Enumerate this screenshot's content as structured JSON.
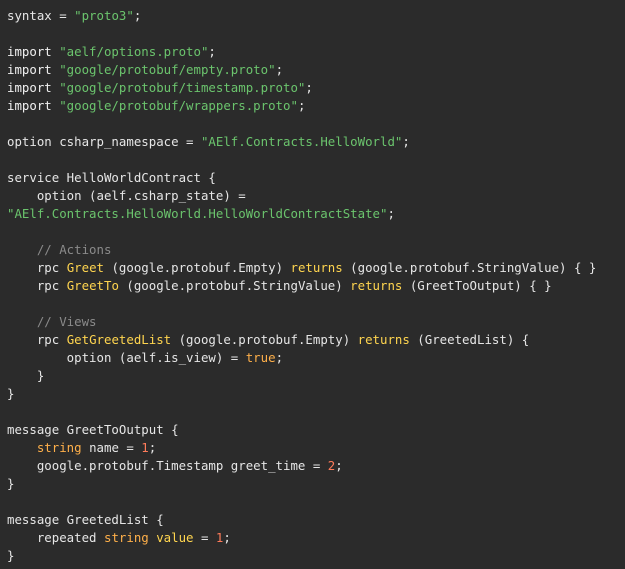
{
  "code": {
    "lines": [
      [
        {
          "t": "syntax = ",
          "c": "plain"
        },
        {
          "t": "\"proto3\"",
          "c": "string"
        },
        {
          "t": ";",
          "c": "punct"
        }
      ],
      [],
      [
        {
          "t": "import ",
          "c": "keyword"
        },
        {
          "t": "\"aelf/options.proto\"",
          "c": "string"
        },
        {
          "t": ";",
          "c": "punct"
        }
      ],
      [
        {
          "t": "import ",
          "c": "keyword"
        },
        {
          "t": "\"google/protobuf/empty.proto\"",
          "c": "string"
        },
        {
          "t": ";",
          "c": "punct"
        }
      ],
      [
        {
          "t": "import ",
          "c": "keyword"
        },
        {
          "t": "\"google/protobuf/timestamp.proto\"",
          "c": "string"
        },
        {
          "t": ";",
          "c": "punct"
        }
      ],
      [
        {
          "t": "import ",
          "c": "keyword"
        },
        {
          "t": "\"google/protobuf/wrappers.proto\"",
          "c": "string"
        },
        {
          "t": ";",
          "c": "punct"
        }
      ],
      [],
      [
        {
          "t": "option csharp_namespace = ",
          "c": "plain"
        },
        {
          "t": "\"AElf.Contracts.HelloWorld\"",
          "c": "string"
        },
        {
          "t": ";",
          "c": "punct"
        }
      ],
      [],
      [
        {
          "t": "service HelloWorldContract {",
          "c": "plain"
        }
      ],
      [
        {
          "t": "    option (aelf.csharp_state) =",
          "c": "plain"
        }
      ],
      [
        {
          "t": "\"AElf.Contracts.HelloWorld.HelloWorldContractState\"",
          "c": "string"
        },
        {
          "t": ";",
          "c": "punct"
        }
      ],
      [],
      [
        {
          "t": "    ",
          "c": "plain"
        },
        {
          "t": "// Actions",
          "c": "comment"
        }
      ],
      [
        {
          "t": "    rpc ",
          "c": "plain"
        },
        {
          "t": "Greet",
          "c": "func"
        },
        {
          "t": " (google.protobuf.Empty) ",
          "c": "plain"
        },
        {
          "t": "returns",
          "c": "func"
        },
        {
          "t": " (google.protobuf.StringValue) { }",
          "c": "plain"
        }
      ],
      [
        {
          "t": "    rpc ",
          "c": "plain"
        },
        {
          "t": "GreetTo",
          "c": "func"
        },
        {
          "t": " (google.protobuf.StringValue) ",
          "c": "plain"
        },
        {
          "t": "returns",
          "c": "func"
        },
        {
          "t": " (GreetToOutput) { }",
          "c": "plain"
        }
      ],
      [],
      [
        {
          "t": "    ",
          "c": "plain"
        },
        {
          "t": "// Views",
          "c": "comment"
        }
      ],
      [
        {
          "t": "    rpc ",
          "c": "plain"
        },
        {
          "t": "GetGreetedList",
          "c": "func"
        },
        {
          "t": " (google.protobuf.Empty) ",
          "c": "plain"
        },
        {
          "t": "returns",
          "c": "func"
        },
        {
          "t": " (GreetedList) {",
          "c": "plain"
        }
      ],
      [
        {
          "t": "        option (aelf.is_view) = ",
          "c": "plain"
        },
        {
          "t": "true",
          "c": "bool"
        },
        {
          "t": ";",
          "c": "punct"
        }
      ],
      [
        {
          "t": "    }",
          "c": "plain"
        }
      ],
      [
        {
          "t": "}",
          "c": "plain"
        }
      ],
      [],
      [
        {
          "t": "message GreetToOutput {",
          "c": "plain"
        }
      ],
      [
        {
          "t": "    ",
          "c": "plain"
        },
        {
          "t": "string",
          "c": "type"
        },
        {
          "t": " name = ",
          "c": "plain"
        },
        {
          "t": "1",
          "c": "number"
        },
        {
          "t": ";",
          "c": "punct"
        }
      ],
      [
        {
          "t": "    google.protobuf.Timestamp greet_time = ",
          "c": "plain"
        },
        {
          "t": "2",
          "c": "number"
        },
        {
          "t": ";",
          "c": "punct"
        }
      ],
      [
        {
          "t": "}",
          "c": "plain"
        }
      ],
      [],
      [
        {
          "t": "message GreetedList {",
          "c": "plain"
        }
      ],
      [
        {
          "t": "    repeated ",
          "c": "plain"
        },
        {
          "t": "string",
          "c": "type"
        },
        {
          "t": " ",
          "c": "plain"
        },
        {
          "t": "value",
          "c": "field"
        },
        {
          "t": " = ",
          "c": "plain"
        },
        {
          "t": "1",
          "c": "number"
        },
        {
          "t": ";",
          "c": "punct"
        }
      ],
      [
        {
          "t": "}",
          "c": "plain"
        }
      ]
    ]
  },
  "colors": {
    "background": "#2b2b2b",
    "plain": "#e6e6e6",
    "string": "#6bc46d",
    "function": "#ffd54f",
    "comment": "#8a8a8a",
    "number": "#ff7b5a",
    "type": "#ffb04a"
  }
}
